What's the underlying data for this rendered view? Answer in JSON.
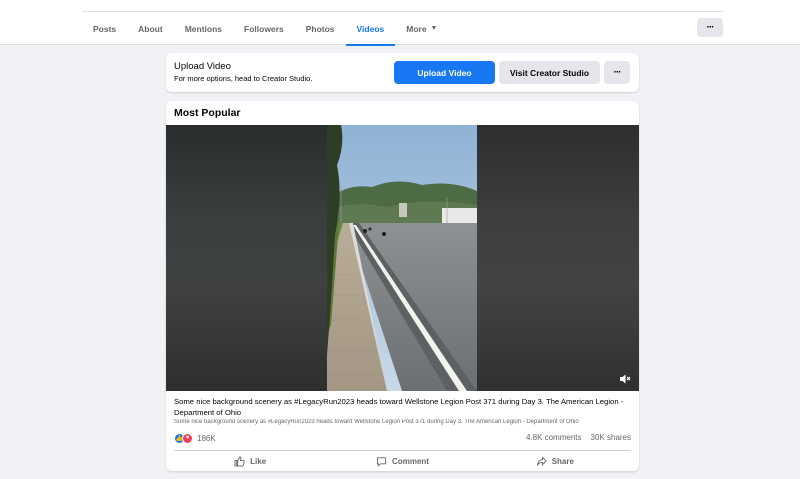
{
  "nav": {
    "tabs": [
      {
        "label": "Posts"
      },
      {
        "label": "About"
      },
      {
        "label": "Mentions"
      },
      {
        "label": "Followers"
      },
      {
        "label": "Photos"
      },
      {
        "label": "Videos"
      },
      {
        "label": "More"
      }
    ],
    "active_tab": "Videos",
    "more_button_label": "···"
  },
  "upload": {
    "title": "Upload Video",
    "subtitle": "For more options, head to Creator Studio.",
    "upload_button": "Upload Video",
    "creator_studio_button": "Visit Creator Studio",
    "options_button": "···"
  },
  "popular": {
    "section_title": "Most Popular",
    "video": {
      "caption": "Some nice background scenery as #LegacyRun2023 heads toward Wellstone Legion Post 371 during Day 3. The American Legion - Department of Ohio",
      "caption_preview": "Some nice background scenery as #LegacyRun2023 heads toward Wellstone Legion Post 371 during Day 3. The American Legion - Department of Ohio",
      "reaction_count": "186K",
      "comments": "4.8K comments",
      "shares": "30K shares",
      "muted": true
    },
    "actions": {
      "like": "Like",
      "comment": "Comment",
      "share": "Share"
    }
  },
  "colors": {
    "accent": "#1877f2",
    "background": "#f0f2f5",
    "secondary_text": "#65676b",
    "love": "#f33e58"
  }
}
